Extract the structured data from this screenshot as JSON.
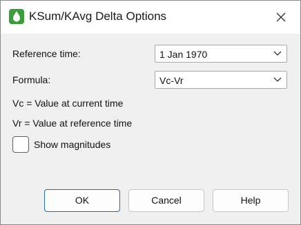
{
  "window": {
    "title": "KSum/KAvg Delta Options",
    "app_icon": "water-drop-icon",
    "close_icon": "close-icon"
  },
  "form": {
    "reference_time_label": "Reference time:",
    "reference_time_value": "1 Jan 1970",
    "formula_label": "Formula:",
    "formula_value": "Vc-Vr",
    "vc_description": "Vc = Value at current time",
    "vr_description": "Vr = Value at reference time",
    "show_magnitudes_label": "Show magnitudes",
    "show_magnitudes_checked": false
  },
  "buttons": {
    "ok": "OK",
    "cancel": "Cancel",
    "help": "Help"
  },
  "colors": {
    "accent": "#1f6fb2",
    "app_icon_bg": "#3b9e3b"
  }
}
